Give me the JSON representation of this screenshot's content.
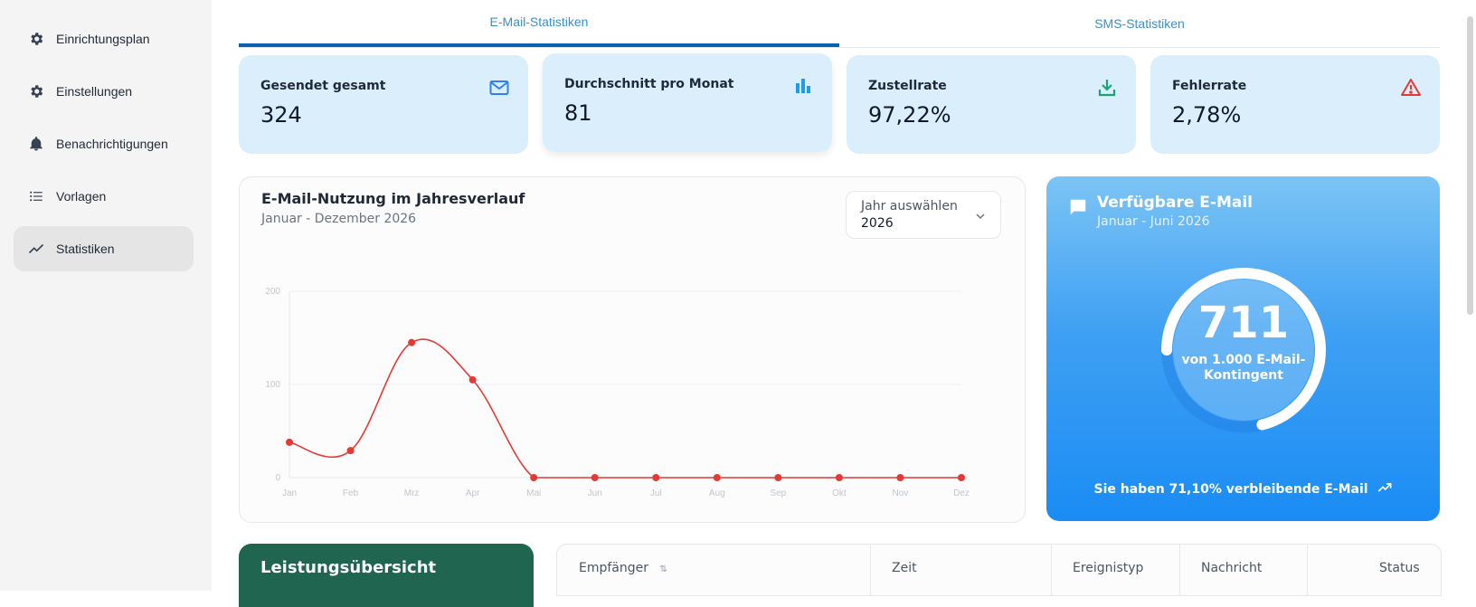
{
  "sidebar": {
    "items": [
      {
        "label": "Einrichtungsplan",
        "icon": "gear-icon"
      },
      {
        "label": "Einstellungen",
        "icon": "gear-icon"
      },
      {
        "label": "Benachrichtigungen",
        "icon": "bell-icon"
      },
      {
        "label": "Vorlagen",
        "icon": "list-icon"
      },
      {
        "label": "Statistiken",
        "icon": "trend-icon",
        "active": true
      }
    ]
  },
  "tabs": [
    {
      "label": "E-Mail-Statistiken",
      "active": true
    },
    {
      "label": "SMS-Statistiken",
      "active": false
    }
  ],
  "stats": [
    {
      "label": "Gesendet gesamt",
      "value": "324",
      "icon": "mail-icon",
      "icon_color": "#2f80ed"
    },
    {
      "label": "Durchschnitt pro Monat",
      "value": "81",
      "icon": "bar-chart-icon",
      "icon_color": "#1e9be9"
    },
    {
      "label": "Zustellrate",
      "value": "97,22%",
      "icon": "download-icon",
      "icon_color": "#17a673"
    },
    {
      "label": "Fehlerrate",
      "value": "2,78%",
      "icon": "warning-icon",
      "icon_color": "#e53935"
    }
  ],
  "usage_chart": {
    "title": "E-Mail-Nutzung im Jahresverlauf",
    "subtitle": "Januar - Dezember 2026",
    "year_select": {
      "label": "Jahr auswählen",
      "value": "2026"
    }
  },
  "chart_data": {
    "type": "line",
    "title": "E-Mail-Nutzung im Jahresverlauf",
    "subtitle": "Januar - Dezember 2026",
    "categories": [
      "Jan",
      "Feb",
      "Mrz",
      "Apr",
      "Mai",
      "Jun",
      "Jul",
      "Aug",
      "Sep",
      "Okt",
      "Nov",
      "Dez"
    ],
    "values": [
      38,
      29,
      145,
      105,
      0,
      0,
      0,
      0,
      0,
      0,
      0,
      0
    ],
    "ylim": [
      0,
      200
    ],
    "yticks": [
      0,
      100,
      200
    ],
    "xlabel": "",
    "ylabel": "",
    "grid": true,
    "color": "#e53935"
  },
  "available": {
    "title": "Verfügbare E-Mail",
    "subtitle": "Januar - Juni 2026",
    "number": "711",
    "caption": "von 1.000 E-Mail-Kontingent",
    "fraction": 0.711,
    "footer": "Sie haben 71,10% verbleibende E-Mail"
  },
  "performance": {
    "title": "Leistungsübersicht"
  },
  "table": {
    "headers": [
      "Empfänger",
      "Zeit",
      "Ereignistyp",
      "Nachricht",
      "Status"
    ]
  }
}
